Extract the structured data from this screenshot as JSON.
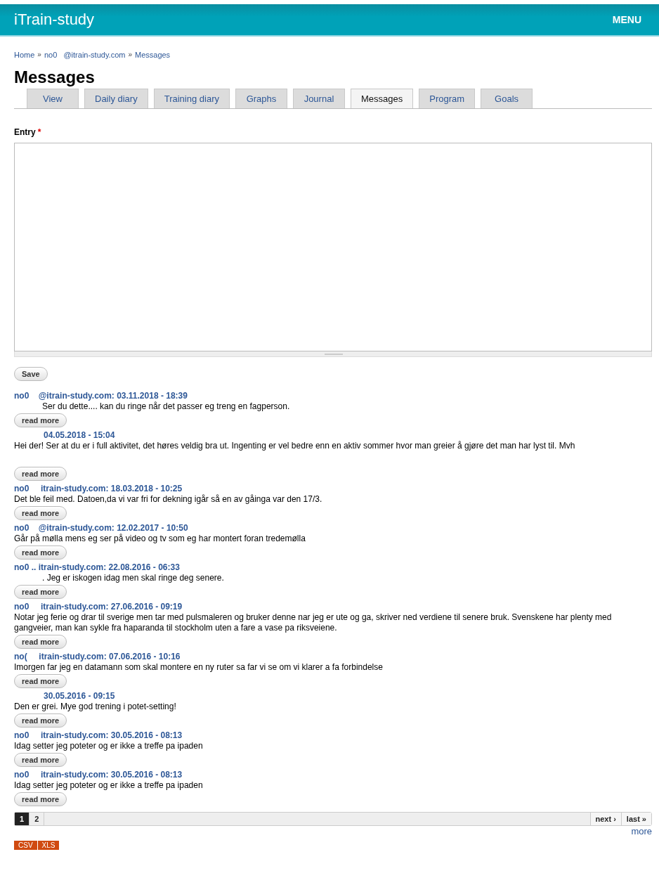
{
  "header": {
    "site_name": "iTrain-study",
    "menu": "MENU"
  },
  "breadcrumb": [
    "Home",
    "no0   @itrain-study.com",
    "Messages"
  ],
  "breadcrumb_separator": "»",
  "title": "Messages",
  "tabs": [
    {
      "label": "View",
      "selected": false
    },
    {
      "label": "Daily diary",
      "selected": false
    },
    {
      "label": "Training diary",
      "selected": false
    },
    {
      "label": "Graphs",
      "selected": false
    },
    {
      "label": "Journal",
      "selected": false
    },
    {
      "label": "Messages",
      "selected": true
    },
    {
      "label": "Program",
      "selected": false
    },
    {
      "label": "Goals",
      "selected": false
    }
  ],
  "entry": {
    "label": "Entry",
    "required_mark": "*",
    "save": "Save"
  },
  "messages": [
    {
      "header": "no0    @itrain-study.com: 03.11.2018 - 18:39",
      "body": "Ser du dette.... kan du ringe når det passer eg treng en fagperson.",
      "indented": true,
      "read_more": "read more"
    },
    {
      "header": "04.05.2018 - 15:04",
      "header_indented": true,
      "body": "Hei der! Ser at du er i full aktivitet, det høres veldig bra ut. Ingenting er vel bedre enn en aktiv sommer hvor man greier å gjøre det man har lyst til. Mvh",
      "blank_line": true,
      "read_more": "read more"
    },
    {
      "header": "no0     itrain-study.com: 18.03.2018 - 10:25",
      "body": "Det ble feil med. Datoen,da vi var fri for dekning igår så en av gåinga var den 17/3.",
      "read_more": "read more"
    },
    {
      "header": "no0    @itrain-study.com: 12.02.2017 - 10:50",
      "body": "Går på mølla mens eg ser på video og tv som eg har montert foran tredemølla",
      "read_more": "read more"
    },
    {
      "header": "no0 .. itrain-study.com: 22.08.2016 - 06:33",
      "body": ". Jeg er iskogen idag men skal ringe deg senere.",
      "indented": true,
      "read_more": "read more"
    },
    {
      "header": "no0     itrain-study.com: 27.06.2016 - 09:19",
      "body": "Notar jeg ferie og drar til sverige men tar med pulsmaleren og bruker denne nar jeg er ute og ga, skriver ned verdiene til senere bruk. Svenskene har plenty med gangveier, man kan sykle fra haparanda til stockholm uten a fare a vase pa riksveiene.",
      "read_more": "read more"
    },
    {
      "header": "no(     itrain-study.com: 07.06.2016 - 10:16",
      "body": "Imorgen far jeg en datamann som skal montere en ny ruter sa far vi se om vi klarer a fa forbindelse",
      "read_more": "read more"
    },
    {
      "header": "30.05.2016 - 09:15",
      "header_indented": true,
      "body": "Den er grei. Mye god trening i potet-setting!",
      "read_more": "read more"
    },
    {
      "header": "no0     itrain-study.com: 30.05.2016 - 08:13",
      "body": "Idag setter jeg poteter og er ikke a treffe pa ipaden",
      "read_more": "read more"
    },
    {
      "header": "no0     itrain-study.com: 30.05.2016 - 08:13",
      "body": "Idag setter jeg poteter og er ikke a treffe pa ipaden",
      "read_more": "read more"
    }
  ],
  "pager": {
    "pages": [
      {
        "label": "1",
        "selected": true
      },
      {
        "label": "2",
        "selected": false
      }
    ],
    "next": "next ›",
    "last": "last »"
  },
  "more": "more",
  "exports": [
    "CSV",
    "XLS"
  ]
}
